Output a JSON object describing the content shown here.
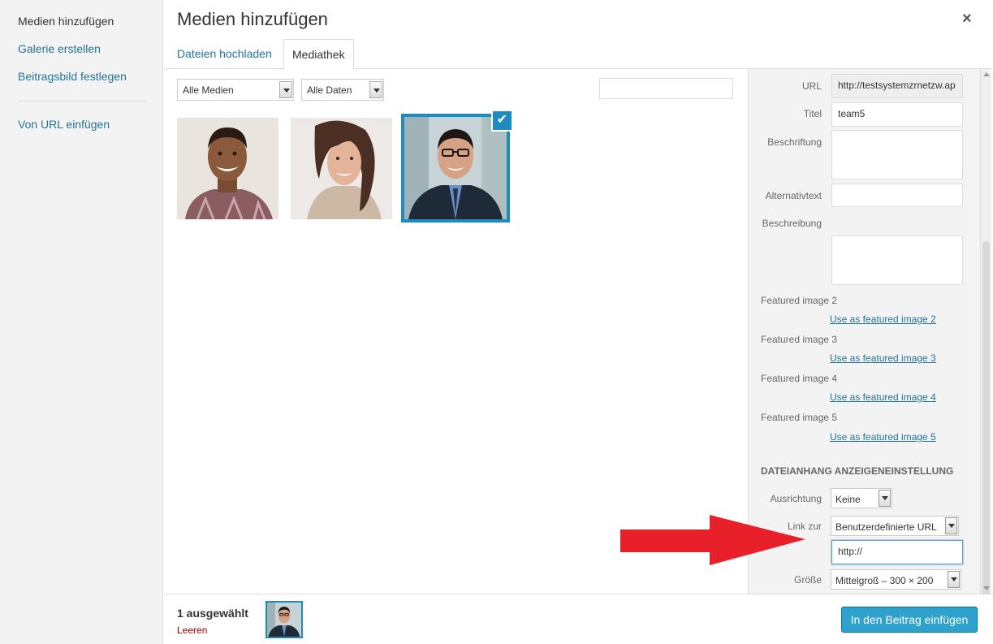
{
  "menu": {
    "items": [
      {
        "label": "Medien hinzufügen"
      },
      {
        "label": "Galerie erstellen"
      },
      {
        "label": "Beitragsbild festlegen"
      },
      {
        "label": "Von URL einfügen"
      }
    ]
  },
  "frame": {
    "title": "Medien hinzufügen",
    "close_glyph": "×"
  },
  "tabs": [
    {
      "label": "Dateien hochladen"
    },
    {
      "label": "Mediathek"
    }
  ],
  "toolbar": {
    "filter_media": "Alle Medien",
    "filter_dates": "Alle Daten",
    "search_placeholder": ""
  },
  "attachments": [
    {
      "icon": "portrait-man-icon",
      "selected": false
    },
    {
      "icon": "portrait-woman-icon",
      "selected": false
    },
    {
      "icon": "portrait-man-glasses-icon",
      "selected": true
    }
  ],
  "details": {
    "url_label": "URL",
    "url_value": "http://testsystemzrnetzw.ap",
    "title_label": "Titel",
    "title_value": "team5",
    "caption_label": "Beschriftung",
    "alt_label": "Alternativtext",
    "description_label": "Beschreibung",
    "featured": [
      {
        "label": "Featured image 2",
        "link": "Use as featured image 2"
      },
      {
        "label": "Featured image 3",
        "link": "Use as featured image 3"
      },
      {
        "label": "Featured image 4",
        "link": "Use as featured image 4"
      },
      {
        "label": "Featured image 5",
        "link": "Use as featured image 5"
      }
    ]
  },
  "display_settings": {
    "heading": "Dateianhang Anzeigeneinstellung",
    "align_label": "Ausrichtung",
    "align_value": "Keine",
    "link_label": "Link zur",
    "link_value": "Benutzerdefinierte URL",
    "link_url_value": "http://",
    "size_label": "Größe",
    "size_value": "Mittelgroß – 300 × 200"
  },
  "selection": {
    "count_text": "1 ausgewählt",
    "clear_label": "Leeren"
  },
  "insert_button": "In den Beitrag einfügen",
  "colors": {
    "accent": "#1e8cbe",
    "link": "#21759b",
    "button": "#2ea2cc",
    "annotation_arrow": "#e8202a"
  }
}
